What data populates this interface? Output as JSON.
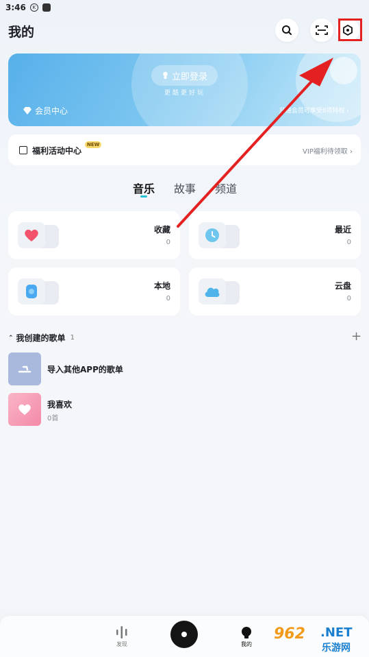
{
  "status": {
    "time": "3:46",
    "icons": [
      "k-icon",
      "app-icon"
    ]
  },
  "header": {
    "title": "我的",
    "icons": [
      "search-icon",
      "scan-icon",
      "settings-icon"
    ]
  },
  "banner": {
    "login_label": "立即登录",
    "login_sub": "更酷更好玩",
    "member_label": "会员中心",
    "member_right": "开通会员可享受8项特权"
  },
  "benefit": {
    "title": "福利活动中心",
    "badge": "NEW",
    "right": "VIP福利待领取"
  },
  "tabs": [
    {
      "label": "音乐",
      "active": true
    },
    {
      "label": "故事",
      "active": false
    },
    {
      "label": "频道",
      "active": false
    }
  ],
  "library": [
    {
      "label": "收藏",
      "count": "0",
      "icon": "heart-icon",
      "color": "#f2526b"
    },
    {
      "label": "最近",
      "count": "0",
      "icon": "clock-icon",
      "color": "#6ec6ee"
    },
    {
      "label": "本地",
      "count": "0",
      "icon": "phone-icon",
      "color": "#4aa8f0"
    },
    {
      "label": "云盘",
      "count": "0",
      "icon": "cloud-icon",
      "color": "#4fb4ea"
    }
  ],
  "playlists": {
    "header": "我创建的歌单",
    "count": "1",
    "items": [
      {
        "title": "导入其他APP的歌单",
        "sub": "",
        "cover_color": "#a8b9dd"
      },
      {
        "title": "我喜欢",
        "sub": "0首",
        "cover_color": "#f7a1b8"
      }
    ]
  },
  "bottom_nav": [
    {
      "label": "发现",
      "icon": "wave-icon"
    },
    {
      "label": "",
      "icon": "disc-icon"
    },
    {
      "label": "我的",
      "icon": "profile-icon"
    }
  ],
  "watermark": {
    "logo": "962",
    "net": ".NET",
    "sub": "乐游网"
  },
  "annotation": {
    "color": "#e32121"
  }
}
